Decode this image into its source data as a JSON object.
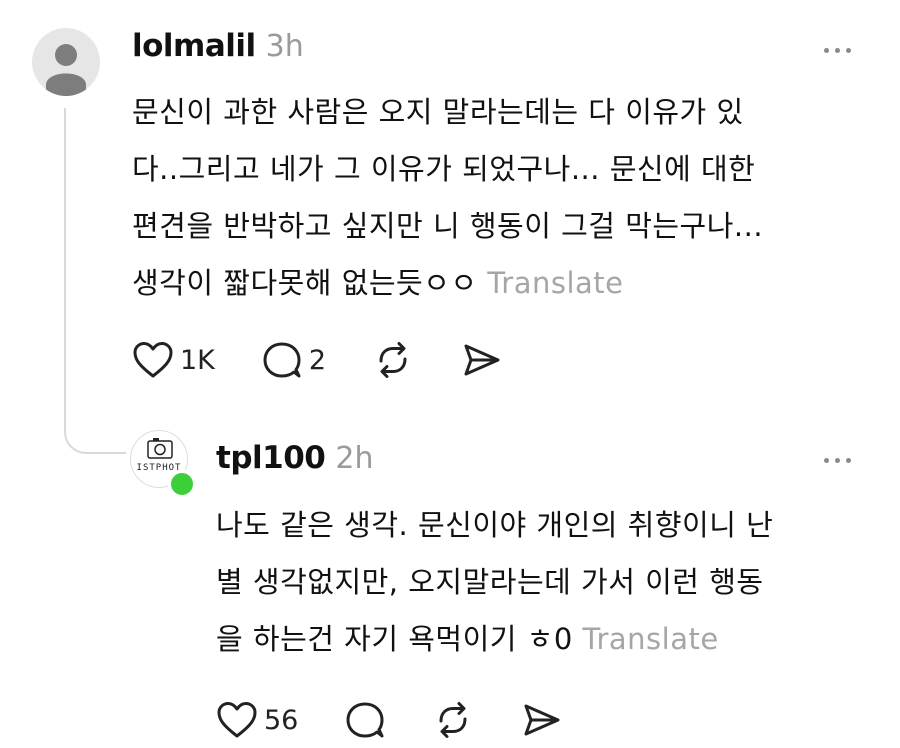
{
  "post": {
    "username": "lolmalil",
    "time": "3h",
    "lines": [
      "문신이 과한 사람은 오지 말라는데는 다 이유가 있",
      "다..그리고 네가 그 이유가 되었구나... 문신에 대한",
      "편견을 반박하고 싶지만 니 행동이 그걸 막는구나...",
      "생각이 짧다못해 없는듯ㅇㅇ"
    ],
    "translate": "Translate",
    "likes": "1K",
    "comments": "2",
    "icons": [
      "heart-icon",
      "comment-icon",
      "repost-icon",
      "share-icon",
      "more-icon"
    ]
  },
  "reply": {
    "username": "tpl100",
    "time": "2h",
    "avatar_text": "ISTPHOT",
    "online_color": "#3ccf3a",
    "lines": [
      "나도 같은 생각. 문신이야 개인의 취향이니 난",
      "별 생각없지만, 오지말라는데 가서 이런 행동",
      "을 하는건 자기 욕먹이기 ㅎ0"
    ],
    "translate": "Translate",
    "likes": "56",
    "icons": [
      "heart-icon",
      "comment-icon",
      "repost-icon",
      "share-icon",
      "more-icon"
    ]
  }
}
